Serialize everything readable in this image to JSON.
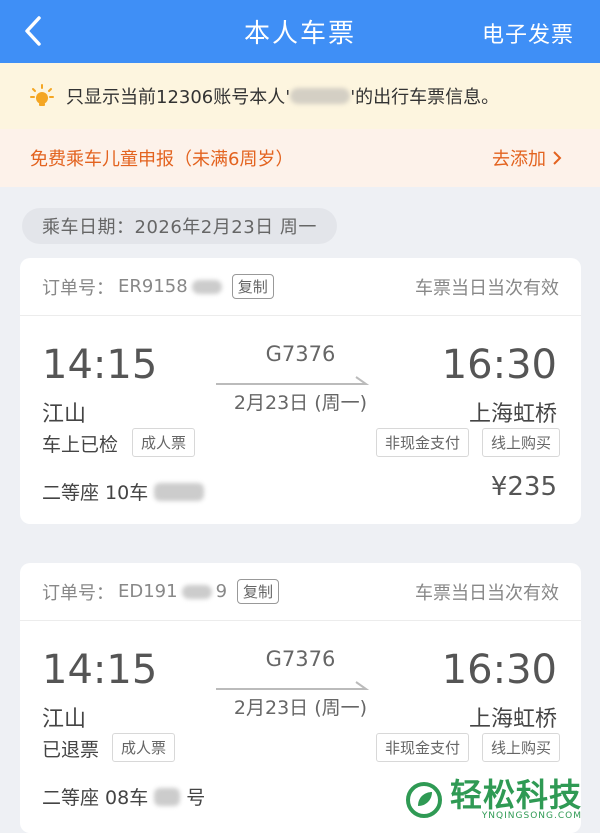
{
  "header": {
    "title": "本人车票",
    "right_label": "电子发票"
  },
  "notice": {
    "prefix": "只显示当前12306账号本人'",
    "suffix": "'的出行车票信息。"
  },
  "child_report": {
    "label": "免费乘车儿童申报（未满6周岁）",
    "link": "去添加"
  },
  "travel_date": "乘车日期：2026年2月23日 周一",
  "tickets": [
    {
      "order_label": "订单号：",
      "order_no": "ER9158",
      "copy_label": "复制",
      "validity": "车票当日当次有效",
      "dep_time": "14:15",
      "arr_time": "16:30",
      "train_no": "G7376",
      "dep_station": "江山",
      "arr_station": "上海虹桥",
      "date": "2月23日 (周一)",
      "status": "车上已检",
      "ticket_type": "成人票",
      "payment": "非现金支付",
      "channel": "线上购买",
      "seat": "二等座 10车",
      "price": "¥235"
    },
    {
      "order_label": "订单号：",
      "order_no": "ED191",
      "order_suffix": "9",
      "copy_label": "复制",
      "validity": "车票当日当次有效",
      "dep_time": "14:15",
      "arr_time": "16:30",
      "train_no": "G7376",
      "dep_station": "江山",
      "arr_station": "上海虹桥",
      "date": "2月23日 (周一)",
      "status": "已退票",
      "ticket_type": "成人票",
      "payment": "非现金支付",
      "channel": "线上购买",
      "seat": "二等座 08车",
      "seat_suffix": "号"
    }
  ],
  "watermark": {
    "text": "轻松科技",
    "sub": "YNQINGSONG.COM"
  },
  "colors": {
    "header": "#3f8ff6",
    "notice_bg": "#fdf5df",
    "child_text": "#e3631f",
    "watermark": "#2f9a54"
  }
}
